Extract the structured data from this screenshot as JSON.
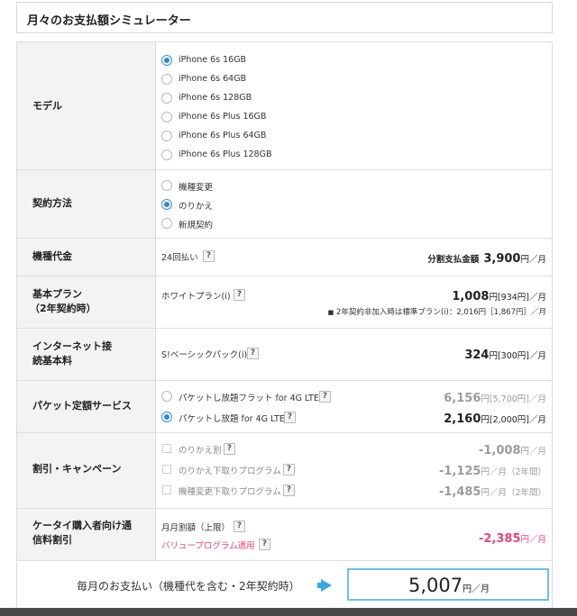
{
  "title": "月々のお支払額シミュレーター",
  "model": {
    "label": "モデル",
    "options": [
      {
        "label": "iPhone 6s 16GB",
        "checked": true
      },
      {
        "label": "iPhone 6s 64GB",
        "checked": false
      },
      {
        "label": "iPhone 6s 128GB",
        "checked": false
      },
      {
        "label": "iPhone 6s Plus 16GB",
        "checked": false
      },
      {
        "label": "iPhone 6s Plus 64GB",
        "checked": false
      },
      {
        "label": "iPhone 6s Plus 128GB",
        "checked": false
      }
    ]
  },
  "contract": {
    "label": "契約方法",
    "options": [
      {
        "label": "機種変更",
        "checked": false
      },
      {
        "label": "のりかえ",
        "checked": true
      },
      {
        "label": "新規契約",
        "checked": false
      }
    ]
  },
  "device_fee": {
    "label": "機種代金",
    "plan": "24回払い",
    "help": "?",
    "price_prefix": "分割支払金額",
    "price": "3,900",
    "unit": "円／月"
  },
  "basic_plan": {
    "label_line1": "基本プラン",
    "label_line2": "（2年契約時）",
    "plan": "ホワイトプラン(i)",
    "help": "?",
    "price": "1,008",
    "price_sub": "円[934円]／月",
    "note_bullet": "■",
    "note": "2年契約非加入時は標準プラン(i)：2,016円［1,867円］／月"
  },
  "internet": {
    "label_line1": "インターネット接",
    "label_line2": "続基本料",
    "plan": "S!ベーシックパック(i)",
    "help": "?",
    "price": "324",
    "price_sub": "円[300円]／月"
  },
  "packet": {
    "label": "パケット定額サービス",
    "options": [
      {
        "label": "パケットし放題フラット for 4G LTE",
        "checked": false,
        "price": "6,156",
        "price_sub": "円[5,700円]／月"
      },
      {
        "label": "パケットし放題 for 4G LTE",
        "checked": true,
        "price": "2,160",
        "price_sub": "円[2,000円]／月"
      }
    ],
    "help": "?"
  },
  "discount": {
    "label": "割引・キャンペーン",
    "options": [
      {
        "label": "のりかえ割",
        "price": "-1,008",
        "price_sub": "円／月"
      },
      {
        "label": "のりかえ下取りプログラム",
        "price": "-1,125",
        "price_sub": "円／月（2年間）"
      },
      {
        "label": "機種変更下取りプログラム",
        "price": "-1,485",
        "price_sub": "円／月（2年間）"
      }
    ],
    "help": "?"
  },
  "keitai": {
    "label_line1": "ケータイ購入者向け通",
    "label_line2": "信料割引",
    "item1": "月月割額（上限）",
    "item2": "バリュープログラム適用",
    "help": "?",
    "price": "-2,385",
    "price_sub": "円／月"
  },
  "footer": {
    "label": "毎月のお支払い（機種代を含む・2年契約時）",
    "total": "5,007",
    "unit": "円／月"
  },
  "colors": {
    "accent": "#2d86df",
    "pink": "#e9437e",
    "total_border": "#6ec0e3",
    "arrow": "#35a9e6"
  }
}
